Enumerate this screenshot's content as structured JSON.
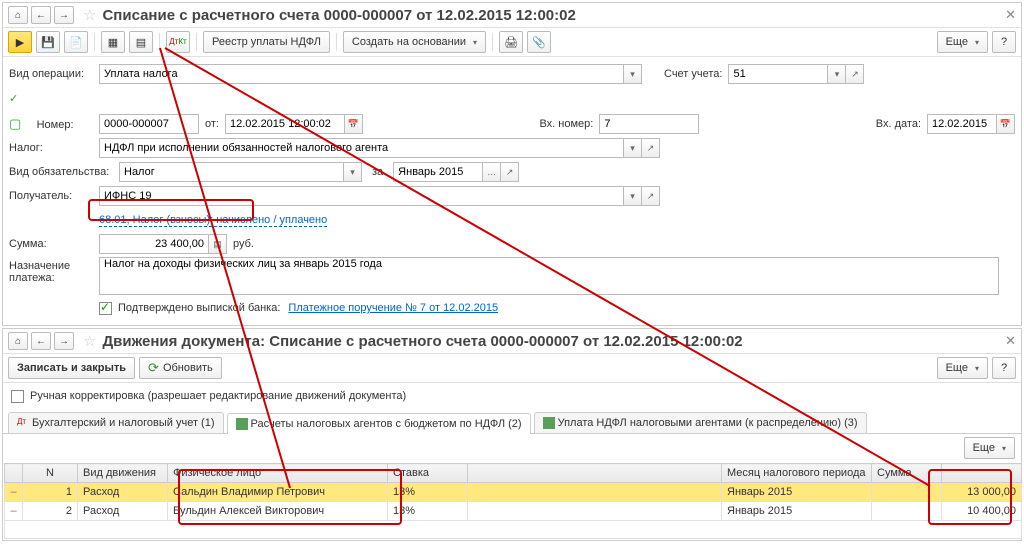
{
  "top": {
    "title": "Списание с расчетного счета 0000-000007 от 12.02.2015 12:00:02",
    "toolbar": {
      "registry_btn": "Реестр уплаты НДФЛ",
      "create_btn": "Создать на основании",
      "more_btn": "Еще"
    },
    "form": {
      "op_type_label": "Вид операции:",
      "op_type_value": "Уплата налога",
      "acct_label": "Счет учета:",
      "acct_value": "51",
      "number_label": "Номер:",
      "number_value": "0000-000007",
      "from_label": "от:",
      "date_value": "12.02.2015 12:00:02",
      "in_number_label": "Вх. номер:",
      "in_number_value": "7",
      "in_date_label": "Вх. дата:",
      "in_date_value": "12.02.2015",
      "tax_label": "Налог:",
      "tax_value": "НДФЛ при исполнении обязанностей налогового агента",
      "obligation_label": "Вид обязательства:",
      "obligation_value": "Налог",
      "period_label": "за",
      "period_value": "Январь 2015",
      "recipient_label": "Получатель:",
      "recipient_value": "ИФНС 19",
      "tax_detail": "68.01, Налог (взносы): начислено / уплачено",
      "sum_label": "Сумма:",
      "sum_value": "23 400,00",
      "currency": "руб.",
      "purpose_label": "Назначение платежа:",
      "purpose_value": "Налог на доходы физических лиц за январь 2015 года",
      "confirmed_label": "Подтверждено выпиской банка:",
      "payment_order_link": "Платежное поручение № 7 от 12.02.2015"
    }
  },
  "bottom": {
    "title": "Движения документа: Списание с расчетного счета 0000-000007 от 12.02.2015 12:00:02",
    "save_btn": "Записать и закрыть",
    "refresh_btn": "Обновить",
    "more_btn": "Еще",
    "manual_edit": "Ручная корректировка (разрешает редактирование движений документа)",
    "tabs": [
      "Бухгалтерский и налоговый учет (1)",
      "Расчеты налоговых агентов с бюджетом по НДФЛ (2)",
      "Уплата НДФЛ налоговыми агентами (к распределению) (3)"
    ],
    "grid": {
      "cols": [
        "N",
        "Вид движения",
        "Физическое лицо",
        "Ставка",
        "",
        "Месяц налогового периода",
        "Сумма",
        ""
      ],
      "rows": [
        {
          "n": "1",
          "move": "Расход",
          "person": "Сальдин Владимир Петрович",
          "rate": "13%",
          "month": "Январь 2015",
          "sum": "13 000,00"
        },
        {
          "n": "2",
          "move": "Расход",
          "person": "Бульдин Алексей Викторович",
          "rate": "13%",
          "month": "Январь 2015",
          "sum": "10 400,00"
        }
      ]
    }
  }
}
